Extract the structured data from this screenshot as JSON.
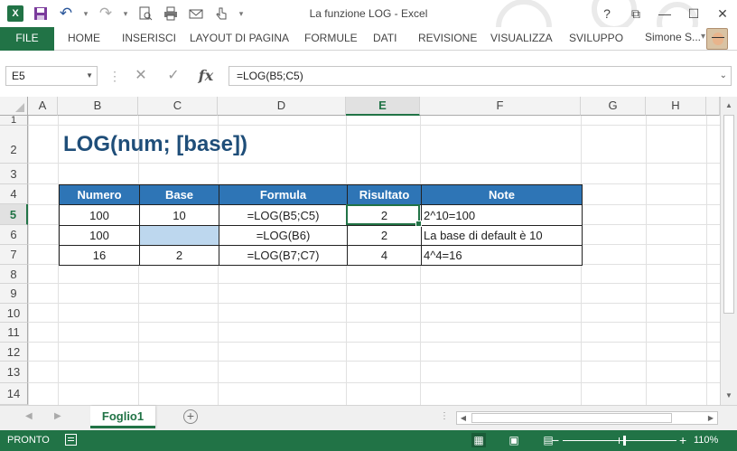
{
  "window": {
    "title": "La funzione LOG - Excel",
    "controls": [
      "?",
      "⧉",
      "—",
      "☐",
      "✕"
    ]
  },
  "ribbon": {
    "file": "FILE",
    "tabs": [
      "HOME",
      "INSERISCI",
      "LAYOUT DI PAGINA",
      "FORMULE",
      "DATI",
      "REVISIONE",
      "VISUALIZZA",
      "SVILUPPO"
    ],
    "user": "Simone S..."
  },
  "formula_bar": {
    "name_box": "E5",
    "formula": "=LOG(B5;C5)"
  },
  "grid": {
    "columns": [
      "A",
      "B",
      "C",
      "D",
      "E",
      "F",
      "G",
      "H"
    ],
    "selected_column": "E",
    "rows": [
      "1",
      "2",
      "3",
      "4",
      "5",
      "6",
      "7",
      "8",
      "9",
      "10",
      "11",
      "12",
      "13",
      "14"
    ],
    "selected_row": "5"
  },
  "sheet_content": {
    "heading": "LOG(num; [base])",
    "table_headers": [
      "Numero",
      "Base",
      "Formula",
      "Risultato",
      "Note"
    ],
    "table_rows": [
      [
        "100",
        "10",
        "=LOG(B5;C5)",
        "2",
        "2^10=100"
      ],
      [
        "100",
        "",
        "=LOG(B6)",
        "2",
        "La base di default è 10"
      ],
      [
        "16",
        "2",
        "=LOG(B7;C7)",
        "4",
        "4^4=16"
      ]
    ]
  },
  "sheets": {
    "active": "Foglio1"
  },
  "status_bar": {
    "ready": "PRONTO",
    "zoom": "110%"
  },
  "colors": {
    "excel_green": "#217346",
    "header_blue": "#2e75b6",
    "heading_blue": "#1f4e79",
    "empty_cell_blue": "#bdd7ee"
  }
}
